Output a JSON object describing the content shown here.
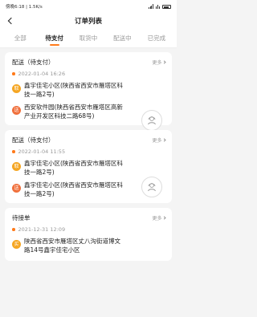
{
  "status_bar": {
    "left": "傍晚6:18 | 1.5K/s",
    "battery": "26"
  },
  "nav": {
    "title": "订单列表"
  },
  "tabs": [
    "全部",
    "待支付",
    "取货中",
    "配送中",
    "已完成"
  ],
  "active_tab": 1,
  "orders": [
    {
      "title": "配送（待支付）",
      "more": "更多",
      "time": "2022-01-04 16:26",
      "pickup_label": "取",
      "pickup": "鑫宇佳宅小区(陕西省西安市雁塔区科技一路2号)",
      "dropoff_label": "送",
      "dropoff": "西安软件园(陕西省西安市雁塔区高新产业开发区科技二路68号)"
    },
    {
      "title": "配送（待支付）",
      "more": "更多",
      "time": "2022-01-04 11:55",
      "pickup_label": "取",
      "pickup": "鑫宇佳宅小区(陕西省西安市雁塔区科技一路2号)",
      "dropoff_label": "送",
      "dropoff": "鑫宇佳宅小区(陕西省西安市雁塔区科技一路2号)"
    },
    {
      "title": "待接单",
      "more": "更多",
      "time": "2021-12-31 12:09",
      "pickup_label": "买",
      "pickup": "陕西省西安市雁塔区丈八沟街道博文路14号鑫宇佳宅小区"
    }
  ],
  "icons": {
    "back": "back-arrow-icon",
    "contact": "contact-icon",
    "more": "chevron-right-icon"
  },
  "colors": {
    "accent": "#ff7a1a",
    "pickup": "#f5a623",
    "dropoff": "#f0703c"
  }
}
